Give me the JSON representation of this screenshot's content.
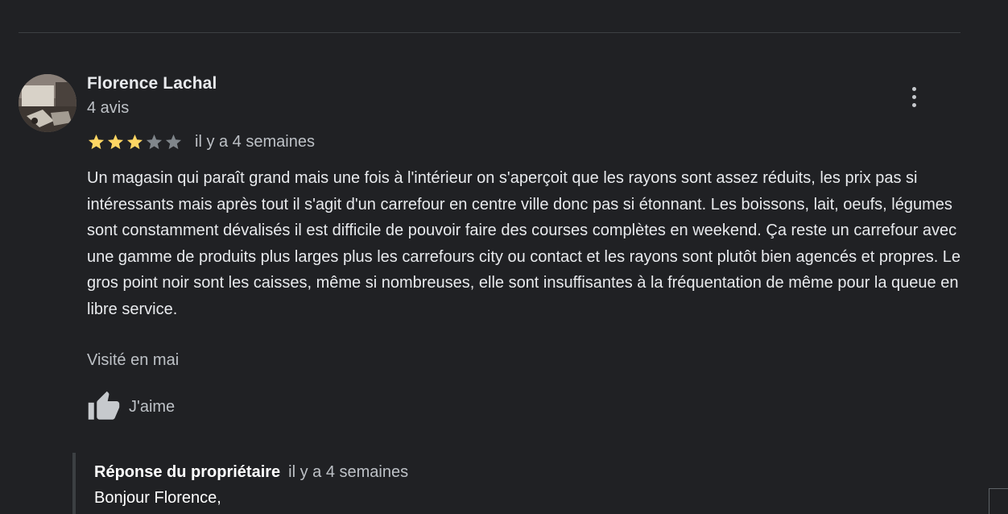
{
  "review": {
    "reviewer_name": "Florence Lachal",
    "review_count": "4 avis",
    "rating": 3,
    "max_rating": 5,
    "date": "il y a 4 semaines",
    "text": "Un magasin qui paraît grand mais une fois à l'intérieur on s'aperçoit que les rayons sont assez réduits, les prix pas si intéressants mais après tout il s'agit d'un carrefour en centre ville donc pas si étonnant. Les boissons, lait, oeufs, légumes sont constamment dévalisés il est difficile de pouvoir faire des courses complètes en weekend. Ça reste un carrefour avec une gamme de produits plus larges plus les carrefours city ou contact et les rayons sont plutôt bien agencés et propres. Le gros point noir sont les caisses, même si nombreuses, elle sont insuffisantes à la fréquentation de même pour la queue en libre service.",
    "visited": "Visité en mai",
    "like_label": "J'aime"
  },
  "owner_reply": {
    "title": "Réponse du propriétaire",
    "date": "il y a 4 semaines",
    "greeting": "Bonjour Florence,"
  },
  "icons": {
    "more": "more-vert-icon",
    "like": "thumb-up-icon",
    "star_filled": "star-filled-icon",
    "star_empty": "star-empty-icon"
  },
  "colors": {
    "background": "#202124",
    "star_filled": "#fdd663",
    "star_empty": "#80868b",
    "text_primary": "#e8eaed",
    "text_secondary": "#bdc1c6"
  }
}
